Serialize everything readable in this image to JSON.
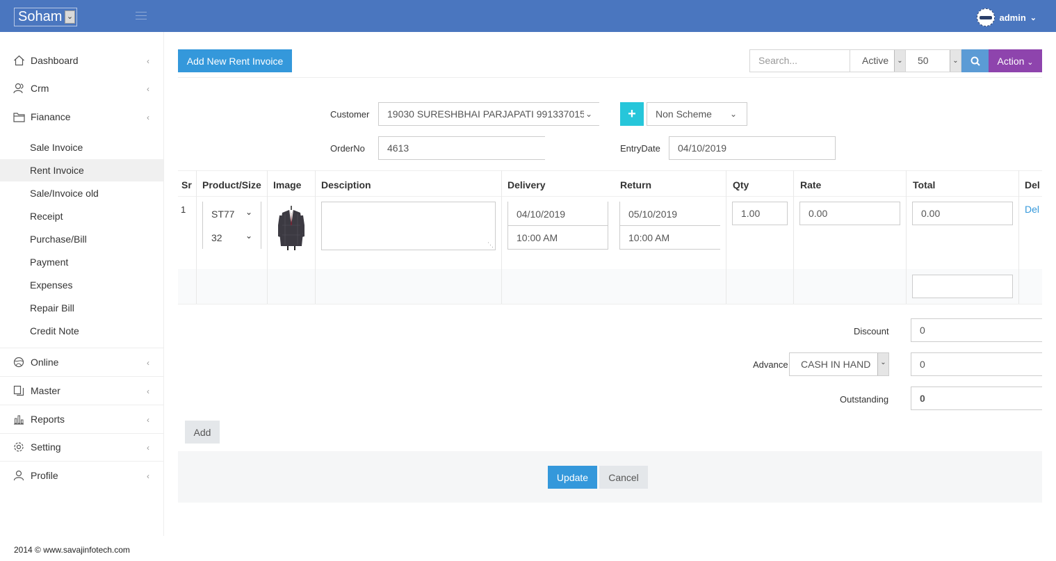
{
  "topbar": {
    "brand": "Soham",
    "user": "admin"
  },
  "sidebar": {
    "items": [
      {
        "label": "Dashboard"
      },
      {
        "label": "Crm"
      },
      {
        "label": "Fianance"
      },
      {
        "label": "Online"
      },
      {
        "label": "Master"
      },
      {
        "label": "Reports"
      },
      {
        "label": "Setting"
      },
      {
        "label": "Profile"
      }
    ],
    "finance_sub": [
      {
        "label": "Sale Invoice"
      },
      {
        "label": "Rent Invoice",
        "active": true
      },
      {
        "label": "Sale/Invoice old"
      },
      {
        "label": "Receipt"
      },
      {
        "label": "Purchase/Bill"
      },
      {
        "label": "Payment"
      },
      {
        "label": "Expenses"
      },
      {
        "label": "Repair Bill"
      },
      {
        "label": "Credit Note"
      }
    ]
  },
  "footer": "2014 © www.savajinfotech.com",
  "toolbar": {
    "add_button": "Add New Rent Invoice",
    "search_placeholder": "Search...",
    "status_value": "Active",
    "page_size": "50",
    "action_label": "Action"
  },
  "form": {
    "customer_label": "Customer",
    "customer_value": "19030 SURESHBHAI PARJAPATI 991337015",
    "scheme_value": "Non Scheme",
    "orderno_label": "OrderNo",
    "orderno_value": "4613",
    "entrydate_label": "EntryDate",
    "entrydate_value": "04/10/2019"
  },
  "table": {
    "headers": [
      "Sr",
      "Product/Size",
      "Image",
      "Desciption",
      "Delivery",
      "Return",
      "Qty",
      "Rate",
      "Total",
      "Del"
    ],
    "row": {
      "sr": "1",
      "product": "ST77",
      "size": "32",
      "description": "",
      "delivery_date": "04/10/2019",
      "delivery_time": "10:00 AM",
      "return_date": "05/10/2019",
      "return_time": "10:00 AM",
      "qty": "1.00",
      "rate": "0.00",
      "total": "0.00",
      "del": "Del"
    },
    "grand_total": ""
  },
  "summary": {
    "discount_label": "Discount",
    "discount_value": "0",
    "advance_label": "Advance",
    "advance_mode": "CASH IN HAND",
    "advance_value": "0",
    "outstanding_label": "Outstanding",
    "outstanding_value": "0"
  },
  "buttons": {
    "add": "Add",
    "update": "Update",
    "cancel": "Cancel"
  }
}
